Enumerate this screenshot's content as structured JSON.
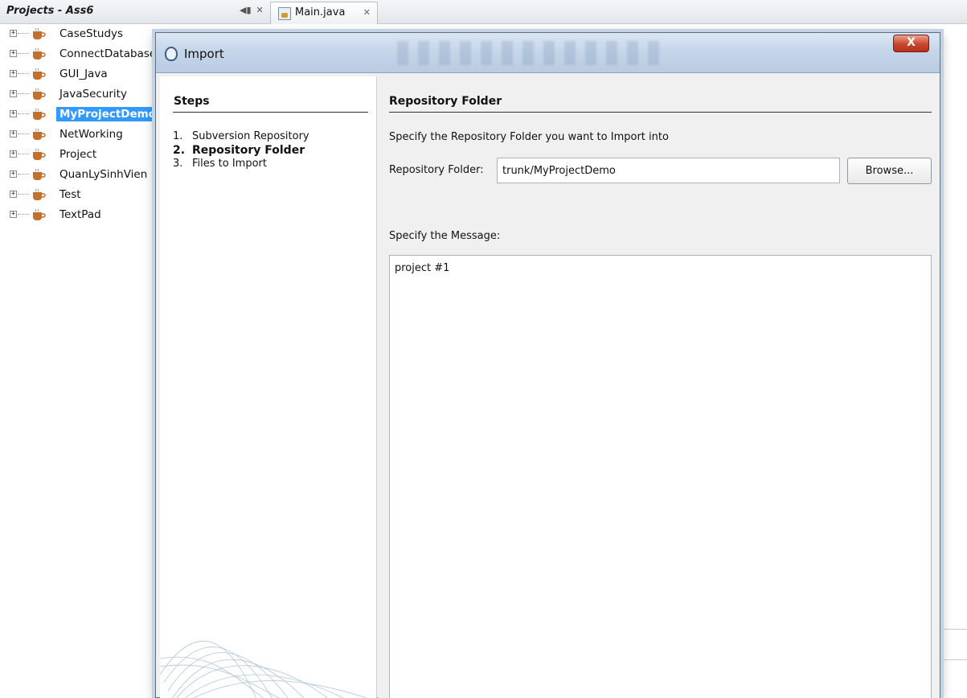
{
  "ide": {
    "projects_title": "Projects - Ass6",
    "editor_tab": "Main.java",
    "projects": [
      {
        "label": "CaseStudys",
        "selected": false
      },
      {
        "label": "ConnectDatabase",
        "selected": false
      },
      {
        "label": "GUI_Java",
        "selected": false
      },
      {
        "label": "JavaSecurity",
        "selected": false
      },
      {
        "label": "MyProjectDemo",
        "selected": true
      },
      {
        "label": "NetWorking",
        "selected": false
      },
      {
        "label": "Project",
        "selected": false
      },
      {
        "label": "QuanLySinhVien",
        "selected": false
      },
      {
        "label": "Test",
        "selected": false
      },
      {
        "label": "TextPad",
        "selected": false
      }
    ]
  },
  "dialog": {
    "title": "Import",
    "close_label": "X",
    "steps": {
      "heading": "Steps",
      "items": [
        {
          "num": "1.",
          "label": "Subversion Repository",
          "active": false
        },
        {
          "num": "2.",
          "label": "Repository Folder",
          "active": true
        },
        {
          "num": "3.",
          "label": "Files to Import",
          "active": false
        }
      ]
    },
    "content": {
      "heading": "Repository Folder",
      "instruction": "Specify the Repository Folder you want to Import into",
      "folder_label": "Repository Folder:",
      "folder_value": "trunk/MyProjectDemo",
      "browse_label": "Browse...",
      "message_label": "Specify the Message:",
      "message_value": "project #1"
    }
  },
  "colors": {
    "selection": "#3399ff",
    "dialog_border": "#c3d3e6",
    "close_button": "#c9462c"
  }
}
